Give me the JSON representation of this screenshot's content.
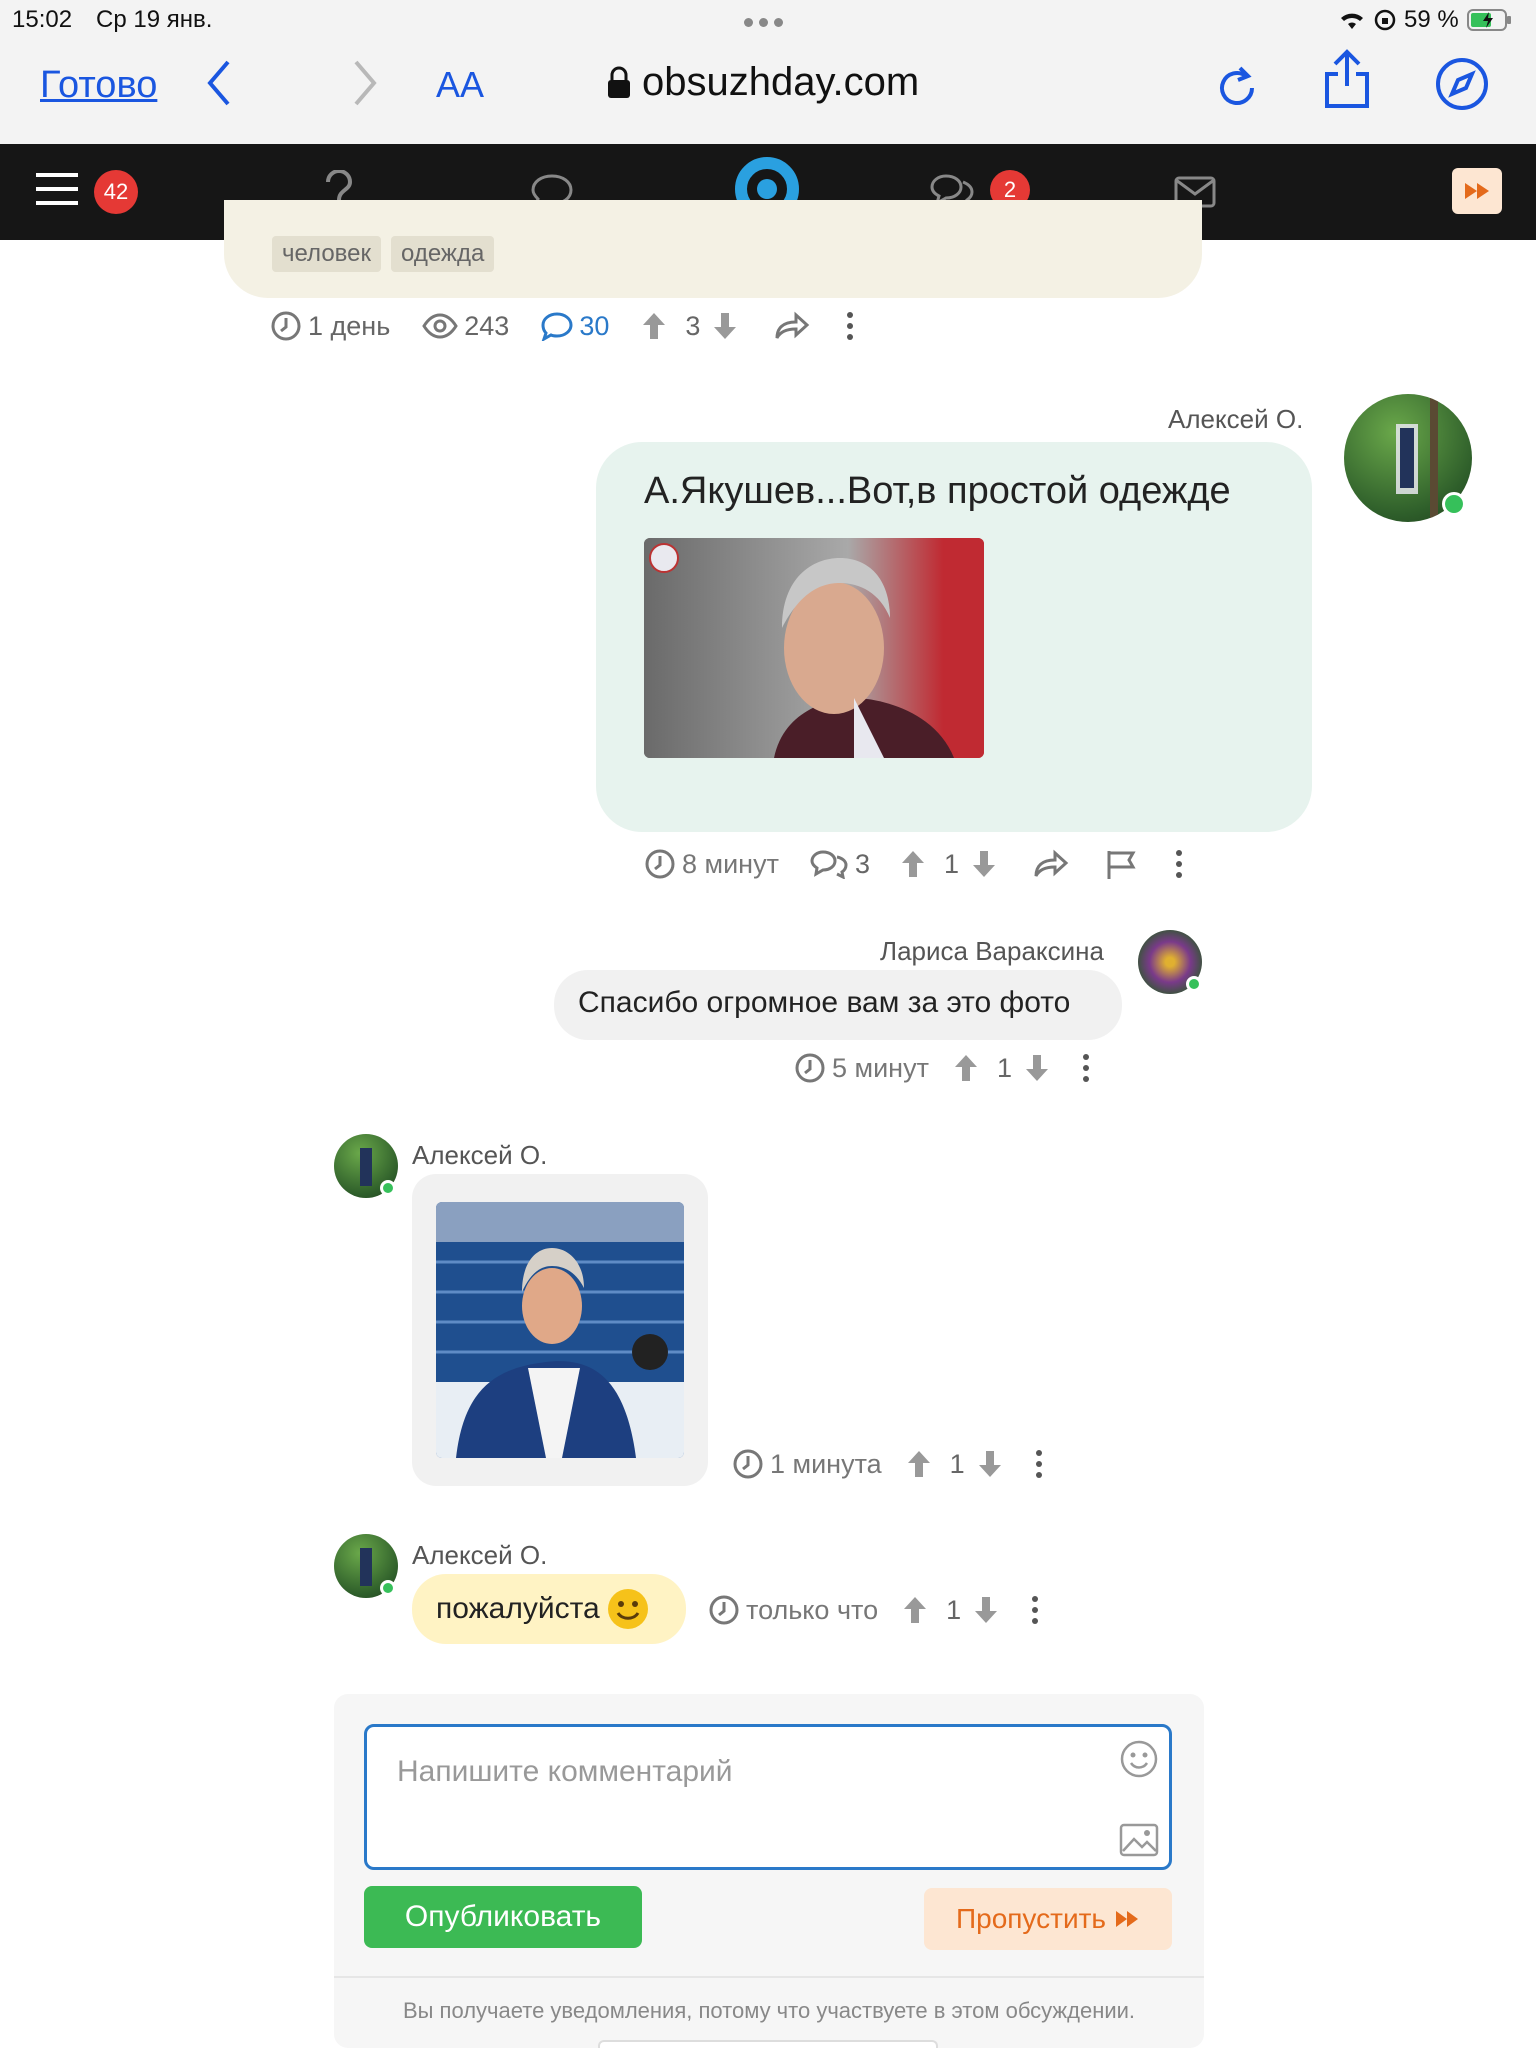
{
  "status": {
    "time": "15:02",
    "date": "Ср 19 янв.",
    "battery": "59 %"
  },
  "safari": {
    "done": "Готово",
    "text_size": "AA",
    "url": "obsuzhday.com"
  },
  "nav": {
    "menu_badge": "42",
    "messages_badge": "2"
  },
  "post": {
    "tags": [
      "человек",
      "одежда"
    ],
    "age": "1 день",
    "views": "243",
    "comments": "30",
    "rating": "3"
  },
  "comments": [
    {
      "author": "Алексей О.",
      "text": "А.Якушев...Вот,в простой одежде",
      "age": "8 минут",
      "replies": "3",
      "rating": "1"
    },
    {
      "author": "Лариса Вараксина",
      "text": "Спасибо огромное вам за это фото",
      "age": "5 минут",
      "rating": "1"
    },
    {
      "author": "Алексей О.",
      "age": "1 минута",
      "rating": "1"
    },
    {
      "author": "Алексей О.",
      "text": "пожалуйста",
      "age": "только что",
      "rating": "1"
    }
  ],
  "composer": {
    "placeholder": "Напишите комментарий",
    "publish": "Опубликовать",
    "skip": "Пропустить",
    "notice": "Вы получаете уведомления, потому что участвуете в этом обсуждении."
  },
  "colors": {
    "accent_blue": "#1a56e0",
    "publish_green": "#3cba54",
    "skip_orange": "#e46a1b",
    "badge_red": "#e53935"
  }
}
